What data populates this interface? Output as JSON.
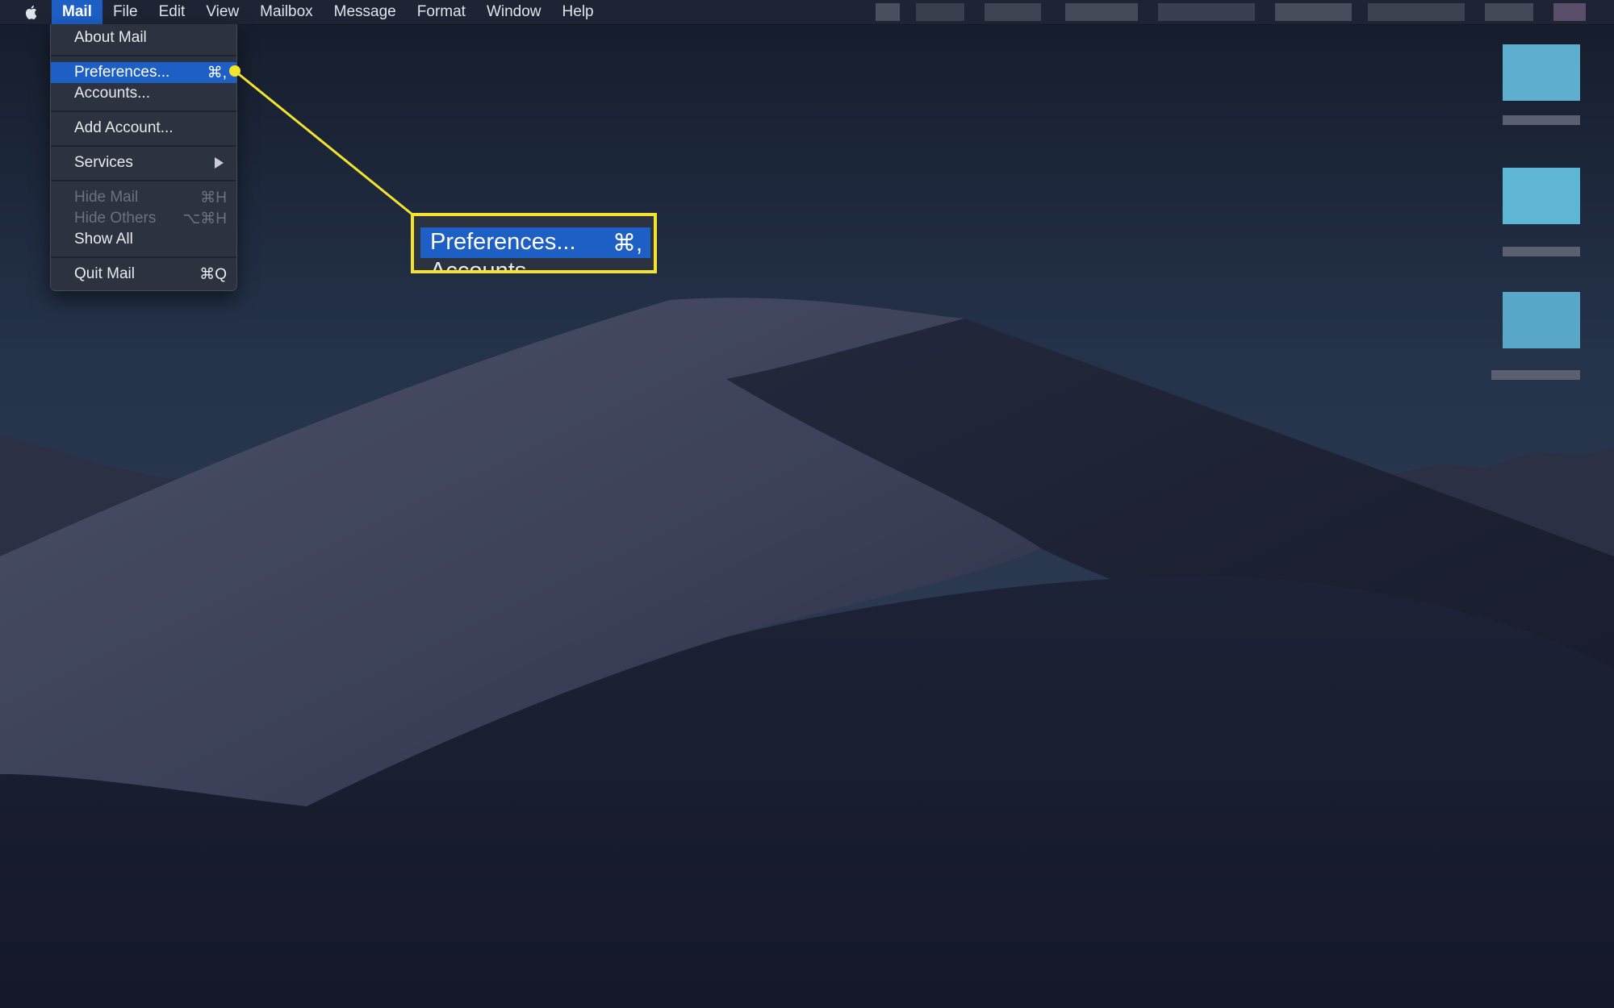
{
  "menubar": {
    "apple_icon": "apple-logo-icon",
    "items": [
      {
        "label": "Mail"
      },
      {
        "label": "File"
      },
      {
        "label": "Edit"
      },
      {
        "label": "View"
      },
      {
        "label": "Mailbox"
      },
      {
        "label": "Message"
      },
      {
        "label": "Format"
      },
      {
        "label": "Window"
      },
      {
        "label": "Help"
      }
    ],
    "active_item": "Mail"
  },
  "mail_menu": {
    "about": "About Mail",
    "preferences": {
      "label": "Preferences...",
      "shortcut": "⌘,"
    },
    "accounts": "Accounts...",
    "add_account": "Add Account...",
    "services": "Services",
    "hide_mail": {
      "label": "Hide Mail",
      "shortcut": "⌘H"
    },
    "hide_others": {
      "label": "Hide Others",
      "shortcut": "⌥⌘H"
    },
    "show_all": "Show All",
    "quit": {
      "label": "Quit Mail",
      "shortcut": "⌘Q"
    }
  },
  "callout": {
    "label": "Preferences...",
    "shortcut": "⌘,",
    "next_label": "Accounts",
    "color": "#f3e32d"
  },
  "colors": {
    "highlight": "#1d5fc4",
    "menu_bg": "#2d3240",
    "sky": "#1c2436"
  }
}
